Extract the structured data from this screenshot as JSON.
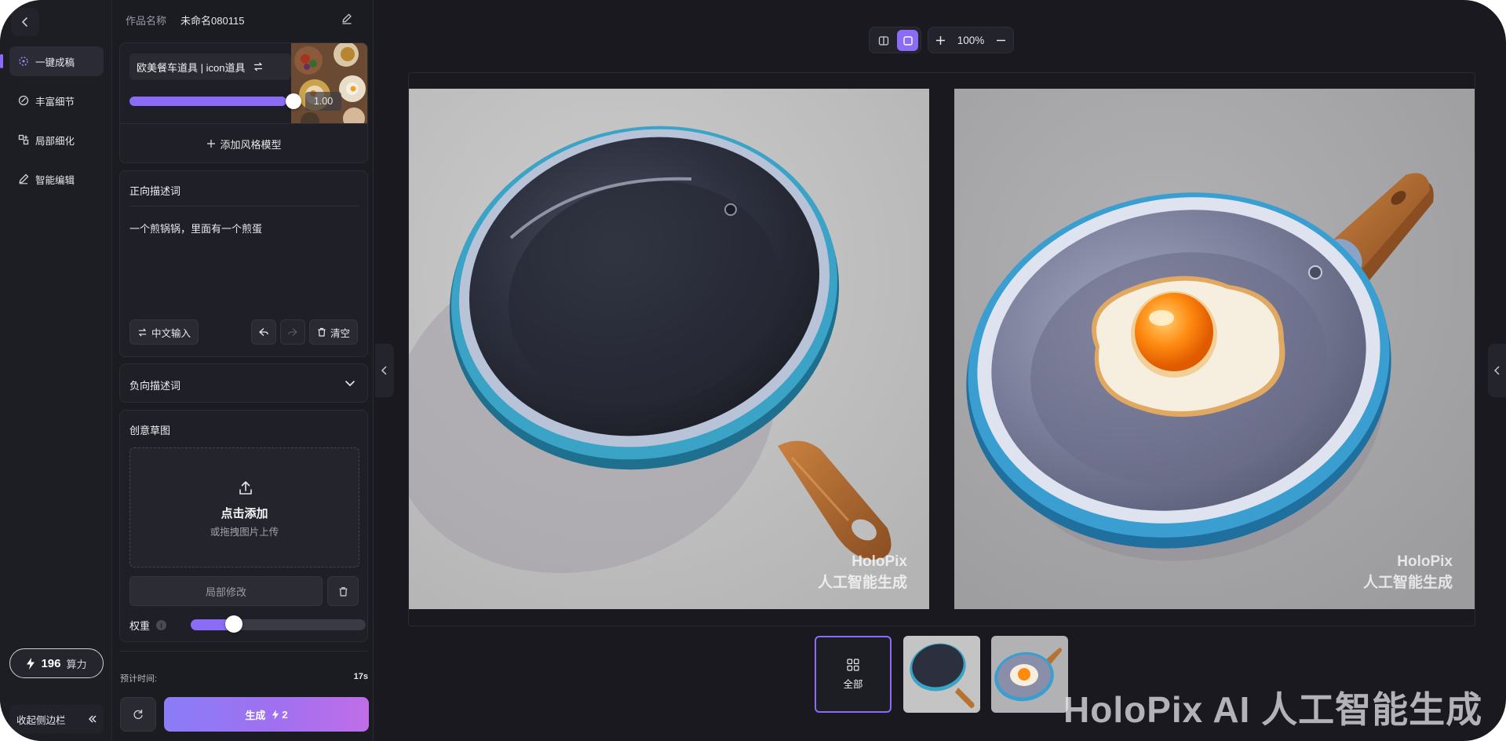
{
  "nav": {
    "back_icon": "chevron-left-icon",
    "items": [
      {
        "label": "一键成稿",
        "icon": "sparkle-icon",
        "active": true
      },
      {
        "label": "丰富细节",
        "icon": "detail-icon",
        "active": false
      },
      {
        "label": "局部细化",
        "icon": "local-refine-icon",
        "active": false
      },
      {
        "label": "智能编辑",
        "icon": "pen-icon",
        "active": false
      }
    ],
    "credits": {
      "value": "196",
      "unit": "算力"
    },
    "collapse_label": "收起侧边栏"
  },
  "panel": {
    "work_name_label": "作品名称",
    "work_name_value": "未命名080115",
    "style_model": {
      "name": "欧美餐车道具 | icon道具",
      "strength": "1.00",
      "strength_fraction": 1.0
    },
    "add_style_label": "添加风格模型",
    "positive_prompt": {
      "title": "正向描述词",
      "text": "一个煎锅锅，里面有一个煎蛋"
    },
    "prompt_buttons": {
      "cn_input": "中文输入",
      "clear": "清空"
    },
    "negative_prompt": {
      "title": "负向描述词"
    },
    "sketch": {
      "title": "创意草图",
      "upload_title": "点击添加",
      "upload_sub": "或拖拽图片上传",
      "local_edit": "局部修改",
      "weight_label": "权重",
      "weight_fraction": 0.25
    },
    "estimate": {
      "label": "预计时间:",
      "value": "17s"
    },
    "generate": {
      "label": "生成",
      "cost": "2"
    }
  },
  "toolbar": {
    "zoom": "100%"
  },
  "canvas": {
    "watermark_line1": "HoloPix",
    "watermark_line2": "人工智能生成"
  },
  "thumbs": {
    "all_label": "全部"
  },
  "bottom_watermark": "HoloPix AI 人工智能生成",
  "colors": {
    "accent": "#8b6cf6",
    "background": "#19191f"
  }
}
